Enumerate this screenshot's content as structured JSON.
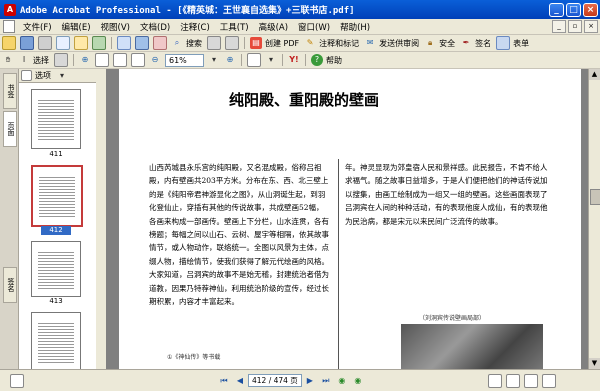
{
  "window": {
    "title": "Adobe Acrobat Professional - [《精英城：王世襄自选集》+三联书店.pdf]",
    "min_label": "_",
    "max_label": "□",
    "close_label": "×"
  },
  "menu": {
    "items": [
      "文件(F)",
      "编辑(E)",
      "视图(V)",
      "文档(D)",
      "注释(C)",
      "工具(T)",
      "高级(A)",
      "窗口(W)",
      "帮助(H)"
    ],
    "close_label": "×"
  },
  "toolbar1": {
    "search_label": "搜索",
    "create_pdf_label": "创建 PDF",
    "review_label": "注释和标记",
    "send_label": "发送供审阅",
    "secure_label": "安全",
    "sign_label": "签名",
    "forms_label": "表单"
  },
  "toolbar2": {
    "select_label": "选择",
    "zoom_value": "61%",
    "help_label": "帮助"
  },
  "sidebar": {
    "tabs": [
      "书签",
      "页面",
      "签名"
    ],
    "options_label": "选项",
    "thumbnails": [
      {
        "label": "411",
        "selected": false
      },
      {
        "label": "412",
        "selected": true
      },
      {
        "label": "413",
        "selected": false
      }
    ]
  },
  "document": {
    "heading": "纯阳殿、重阳殿的壁画",
    "col_left": "山西芮城县永乐宫的纯阳殿，又名混成殿，俗称吕祖殿，内有壁画共203平方米。分布在东、西、北三壁上的是《纯阳帝君神游显化之图》，从山洞诞生起，到羽化登仙止，穿插有其他的传说故事，共成壁画52幅，各画来构成一部画传。壁画上下分栏，山水连贯，各有榜题；每幅之间以山石、云树、屋宇等相隔，依其故事情节，或人物动作，联络统一。全图以风景为主体，点缀人物，描绘情节，使我们获得了解元代绘画的风格。大家知道，吕洞宾的故事不是始无稽，封建统治者借为道教，因果乃特荐神仙，利用统治阶级的宣传，经过长期积累，内容才丰富起来。",
    "col_right": "年。神灵显现为郊皇宿人民和景祥感。此民报告，不肯不给人求福气。随之故事日益增多，于是人们便把他们的神话传说加以搜集，由画工绘制成为一组又一组的壁画。这些画面表现了吕洞宾在人间的种种活动，有的表现他度人成仙，有的表现他为民治病，都是宋元以来民间广泛流传的故事。",
    "photo_caption": "（刘洞宾传说壁画局部）",
    "footnote": "①《神仙传》等书载"
  },
  "statusbar": {
    "page_display": "412 / 474 页"
  }
}
